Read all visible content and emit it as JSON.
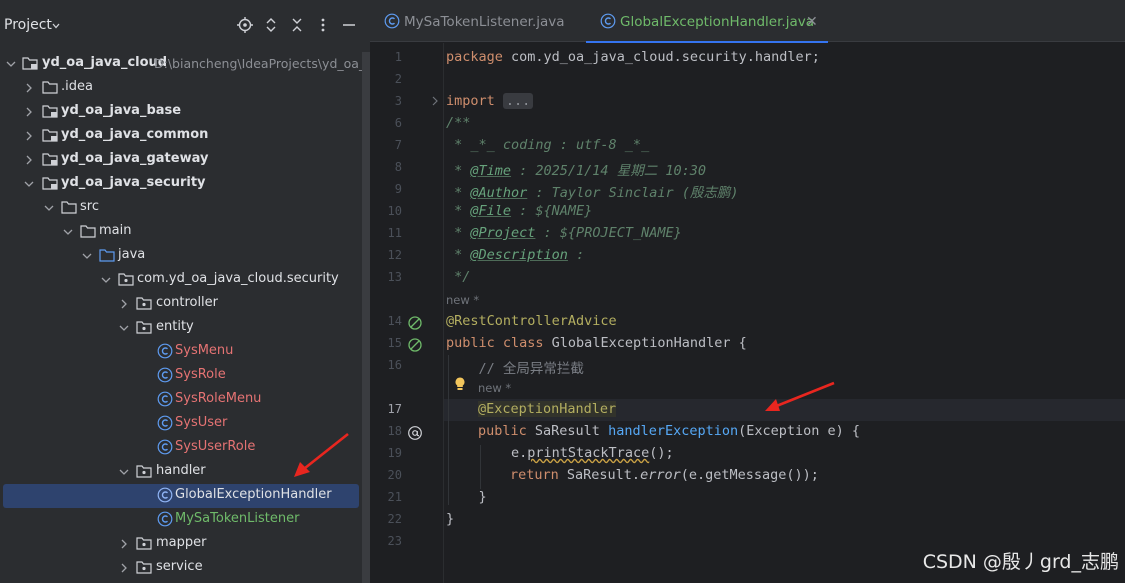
{
  "project_panel": {
    "title": "Project",
    "tree": [
      {
        "label": "yd_oa_java_cloud",
        "path": "D:\\biancheng\\IdeaProjects\\yd_oa_j"
      },
      {
        "label": ".idea"
      },
      {
        "label": "yd_oa_java_base"
      },
      {
        "label": "yd_oa_java_common"
      },
      {
        "label": "yd_oa_java_gateway"
      },
      {
        "label": "yd_oa_java_security"
      },
      {
        "label": "src"
      },
      {
        "label": "main"
      },
      {
        "label": "java"
      },
      {
        "label": "com.yd_oa_java_cloud.security"
      },
      {
        "label": "controller"
      },
      {
        "label": "entity"
      },
      {
        "label": "SysMenu"
      },
      {
        "label": "SysRole"
      },
      {
        "label": "SysRoleMenu"
      },
      {
        "label": "SysUser"
      },
      {
        "label": "SysUserRole"
      },
      {
        "label": "handler"
      },
      {
        "label": "GlobalExceptionHandler"
      },
      {
        "label": "MySaTokenListener"
      },
      {
        "label": "mapper"
      },
      {
        "label": "service"
      }
    ]
  },
  "tabs": [
    {
      "label": "MySaTokenListener.java",
      "active": false
    },
    {
      "label": "GlobalExceptionHandler.java",
      "active": true
    }
  ],
  "editor": {
    "line_numbers": [
      "1",
      "2",
      "3",
      "6",
      "7",
      "8",
      "9",
      "10",
      "11",
      "12",
      "13",
      "14",
      "15",
      "16",
      "17",
      "18",
      "19",
      "20",
      "21",
      "22",
      "23"
    ],
    "hint_new": "new *",
    "code": {
      "l1_kw": "package",
      "l1_rest": " com.yd_oa_java_cloud.security.handler;",
      "l3_kw": "import",
      "l3_fold": "...",
      "l6": "/**",
      "l7": " * _*_ coding : utf-8 _*_",
      "l8_tag": "@Time",
      "l8_rest": " : 2025/1/14 星期二 10:30",
      "l9_tag": "@Author",
      "l9_rest": " : Taylor Sinclair (殷志鹏)",
      "l10_tag": "@File",
      "l10_rest": " : ${NAME}",
      "l11_tag": "@Project",
      "l11_rest": " : ${PROJECT_NAME}",
      "l12_tag": "@Description",
      "l12_rest": " :",
      "l13": " */",
      "l14": "@RestControllerAdvice",
      "l15_kw": "public class",
      "l15_rest": " GlobalExceptionHandler {",
      "l16": "    // 全局异常拦截",
      "l17": "@ExceptionHandler",
      "l18_kw": "public",
      "l18_type": " SaResult ",
      "l18_fn": "handlerException",
      "l18_rest": "(Exception e) {",
      "l19_pre": "        e.",
      "l19_call": "printStackTrace",
      "l19_rest": "();",
      "l20_kw": "return",
      "l20_pre": " SaResult.",
      "l20_call": "error",
      "l20_rest": "(e.getMessage());",
      "l21": "    }",
      "l22": "}"
    }
  },
  "watermark": "CSDN @殷丿grd_志鹏",
  "colors": {
    "selection": "#2e436e",
    "accent_tab": "#3574f0",
    "annotation_arrow": "#e8261f"
  }
}
